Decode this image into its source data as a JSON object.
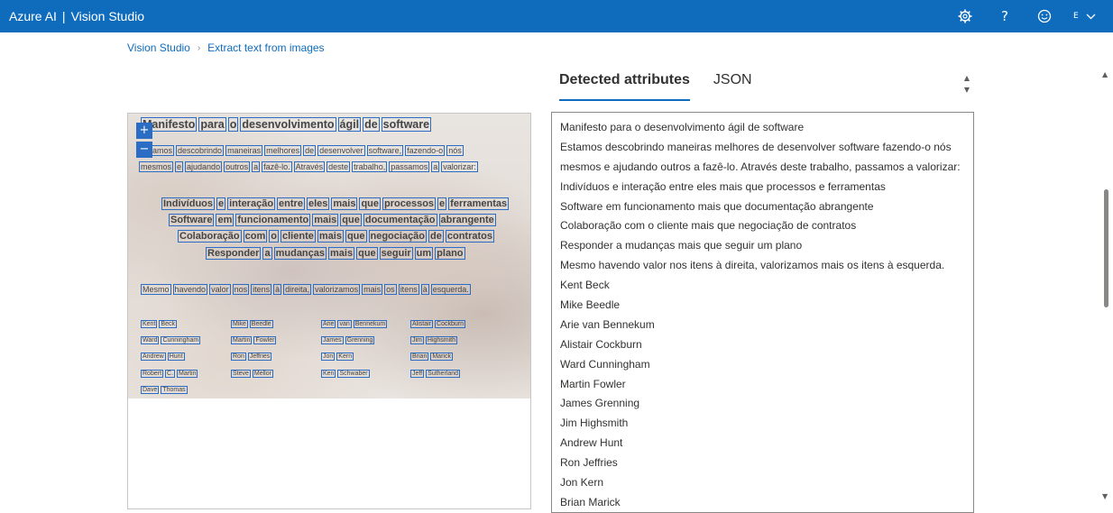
{
  "topbar": {
    "brand": "Azure AI",
    "separator": "|",
    "product": "Vision Studio",
    "user_initial": "E",
    "icons": [
      "gear-icon",
      "help-icon",
      "smiley-icon",
      "chevron-down-icon"
    ],
    "accent_color": "#0f6cbd"
  },
  "breadcrumb": {
    "root": "Vision Studio",
    "current": "Extract text from images"
  },
  "tabs": [
    {
      "label": "Detected attributes",
      "active": true
    },
    {
      "label": "JSON",
      "active": false
    }
  ],
  "ocr_image": {
    "title_words": [
      "Manifesto",
      "para",
      "o",
      "desenvolvimento",
      "ágil",
      "de",
      "software"
    ],
    "line1_words": [
      "Estamos",
      "descobrindo",
      "maneiras",
      "melhores",
      "de",
      "desenvolver",
      "software,",
      "fazendo-o",
      "nós"
    ],
    "line2_words": [
      "mesmos",
      "e",
      "ajudando",
      "outros",
      "a",
      "fazê-lo.",
      "Através",
      "deste",
      "trabalho,",
      "passamos",
      "a",
      "valorizar:"
    ],
    "values": [
      [
        "Indivíduos",
        "e",
        "interação",
        "entre",
        "eles",
        "mais",
        "que",
        "processos",
        "e",
        "ferramentas"
      ],
      [
        "Software",
        "em",
        "funcionamento",
        "mais",
        "que",
        "documentação",
        "abrangente"
      ],
      [
        "Colaboração",
        "com",
        "o",
        "cliente",
        "mais",
        "que",
        "negociação",
        "de",
        "contratos"
      ],
      [
        "Responder",
        "a",
        "mudanças",
        "mais",
        "que",
        "seguir",
        "um",
        "plano"
      ]
    ],
    "closing_words": [
      "Mesmo",
      "havendo",
      "valor",
      "nos",
      "itens",
      "à",
      "direita,",
      "valorizamos",
      "mais",
      "os",
      "itens",
      "à",
      "esquerda."
    ],
    "names_grid": [
      [
        "Kent Beck",
        "Mike Beedle",
        "Arie van Bennekum",
        "Alistair Cockburn"
      ],
      [
        "Ward Cunningham",
        "Martin Fowler",
        "James Grenning",
        "Jim Highsmith"
      ],
      [
        "Andrew Hunt",
        "Ron Jeffries",
        "Jon Kern",
        "Brian Marick"
      ],
      [
        "Robert C. Martin",
        "Steve Mellor",
        "Ken Schwaber",
        "Jeff Sutherland"
      ],
      [
        "Dave Thomas",
        "",
        "",
        ""
      ]
    ],
    "zoom_in": "+",
    "zoom_out": "−"
  },
  "detected_lines": [
    "Manifesto para o desenvolvimento ágil de software",
    "Estamos descobrindo maneiras melhores de desenvolver software fazendo-o nós",
    "mesmos e ajudando outros a fazê-lo. Através deste trabalho, passamos a valorizar:",
    "Indivíduos e interação entre eles mais que processos e ferramentas",
    "Software em funcionamento mais que documentação abrangente",
    "Colaboração com o cliente mais que negociação de contratos",
    "Responder a mudanças mais que seguir um plano",
    "Mesmo havendo valor nos itens à direita, valorizamos mais os itens à esquerda.",
    "Kent Beck",
    "Mike Beedle",
    "Arie van Bennekum",
    "Alistair Cockburn",
    "Ward Cunningham",
    "Martin Fowler",
    "James Grenning",
    "Jim Highsmith",
    "Andrew Hunt",
    "Ron Jeffries",
    "Jon Kern",
    "Brian Marick"
  ]
}
